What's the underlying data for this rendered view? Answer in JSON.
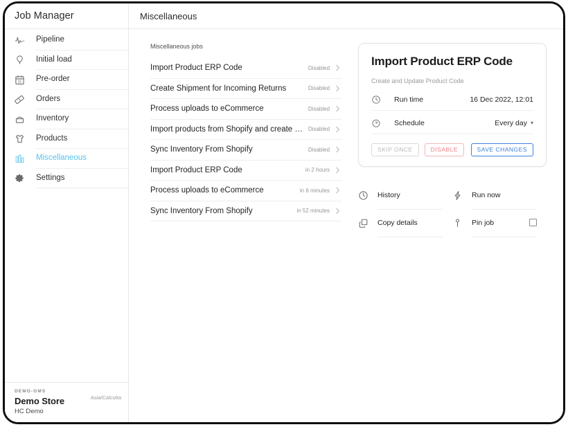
{
  "window": {
    "sidebar_title": "Job Manager",
    "main_title": "Miscellaneous"
  },
  "sidebar": {
    "items": [
      {
        "label": "Pipeline",
        "icon": "pulse-icon",
        "active": false
      },
      {
        "label": "Initial load",
        "icon": "balloon-icon",
        "active": false
      },
      {
        "label": "Pre-order",
        "icon": "calendar-icon",
        "active": false
      },
      {
        "label": "Orders",
        "icon": "ticket-icon",
        "active": false
      },
      {
        "label": "Inventory",
        "icon": "box-icon",
        "active": false
      },
      {
        "label": "Products",
        "icon": "tshirt-icon",
        "active": false
      },
      {
        "label": "Miscellaneous",
        "icon": "bars-icon",
        "active": true
      },
      {
        "label": "Settings",
        "icon": "gear-icon",
        "active": false
      }
    ],
    "footer": {
      "store_code": "DEMO-OMS",
      "store_name": "Demo Store",
      "store_sub": "HC Demo",
      "timezone": "Asia/Calcutta"
    }
  },
  "joblist": {
    "caption": "Miscellaneous jobs",
    "rows": [
      {
        "name": "Import Product ERP Code",
        "status": "Disabled"
      },
      {
        "name": "Create Shipment for Incoming Returns",
        "status": "Disabled"
      },
      {
        "name": "Process uploads to eCommerce",
        "status": "Disabled"
      },
      {
        "name": "Import products from Shopify and create …",
        "status": "Disabled"
      },
      {
        "name": "Sync Inventory From Shopify",
        "status": "Disabled"
      },
      {
        "name": "Import Product ERP Code",
        "status": "in 2 hours"
      },
      {
        "name": "Process uploads to eCommerce",
        "status": "in 6 minutes"
      },
      {
        "name": "Sync Inventory From Shopify",
        "status": "in 52 minutes"
      }
    ]
  },
  "detail": {
    "title": "Import Product ERP Code",
    "subtitle": "Create and Update Product Code",
    "rows": [
      {
        "icon": "clock-icon",
        "label": "Run time",
        "value": "16 Dec 2022, 12:01",
        "has_caret": false
      },
      {
        "icon": "stopwatch-icon",
        "label": "Schedule",
        "value": "Every day",
        "has_caret": true
      }
    ],
    "buttons": {
      "skip_once": "SKIP ONCE",
      "disable": "DISABLE",
      "save_changes": "SAVE CHANGES"
    },
    "actions": [
      {
        "label": "History",
        "icon": "clock-icon",
        "checkbox": false
      },
      {
        "label": "Run now",
        "icon": "lightning-icon",
        "checkbox": false
      },
      {
        "label": "Copy details",
        "icon": "copy-icon",
        "checkbox": false
      },
      {
        "label": "Pin job",
        "icon": "pin-icon",
        "checkbox": true
      }
    ]
  },
  "colors": {
    "accent_blue": "#54c4ef",
    "save_blue": "#3a7fe0",
    "disable_red": "#ef7f88",
    "muted_gray": "#959595"
  }
}
